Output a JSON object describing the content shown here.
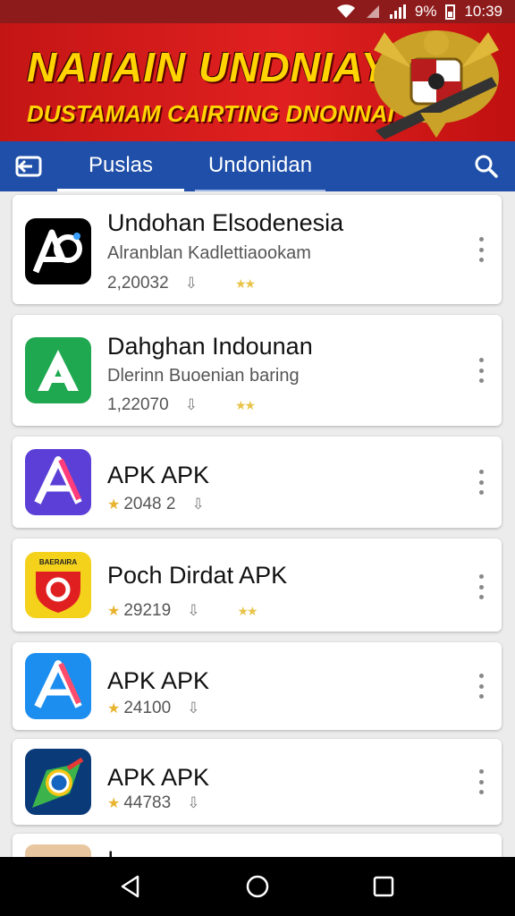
{
  "status_bar": {
    "battery": "9%",
    "time": "10:39"
  },
  "banner": {
    "headline": "NAIIAIN UNDNIAY",
    "subheadline": "DUSTAMAM CAIRTING DNONNAI"
  },
  "tabs": [
    {
      "label": "Puslas",
      "active": true
    },
    {
      "label": "Undonidan",
      "active": false
    }
  ],
  "apps": [
    {
      "title": "Undohan Elsodenesia",
      "subtitle": "Alranblan Kadlettiaookam",
      "count": "2,20032",
      "icon": "ap-logo-icon",
      "icon_bg": "#000000",
      "rating_stars": 2
    },
    {
      "title": "Dahghan Indounan",
      "subtitle": "Dlerinn Buoenian baring",
      "count": "1,22070",
      "icon": "green-a-icon",
      "icon_bg": "#1fa84f",
      "rating_stars": 2
    },
    {
      "title": "APK APK",
      "subtitle": "",
      "count": "2048 2",
      "icon": "purple-a-icon",
      "icon_bg": "#5b3fd6",
      "rating_stars": 0
    },
    {
      "title": "Poch Dirdat APK",
      "subtitle": "",
      "count": "29219",
      "icon": "red-shield-icon",
      "icon_bg": "#f4d21c",
      "icon_text": "BAERAIRA",
      "rating_stars": 2
    },
    {
      "title": "APK APK",
      "subtitle": "",
      "count": "24100",
      "icon": "blue-a-icon",
      "icon_bg": "#1c8ef0",
      "rating_stars": 0
    },
    {
      "title": "APK APK",
      "subtitle": "",
      "count": "44783",
      "icon": "map-pin-icon",
      "icon_bg": "#0b3a78",
      "rating_stars": 0
    }
  ],
  "partial_card": {
    "title": "I"
  },
  "colors": {
    "header_blue": "#1f4fa8",
    "banner_red": "#d81b1b",
    "banner_text": "#ffd400",
    "star": "#e8c44a"
  }
}
